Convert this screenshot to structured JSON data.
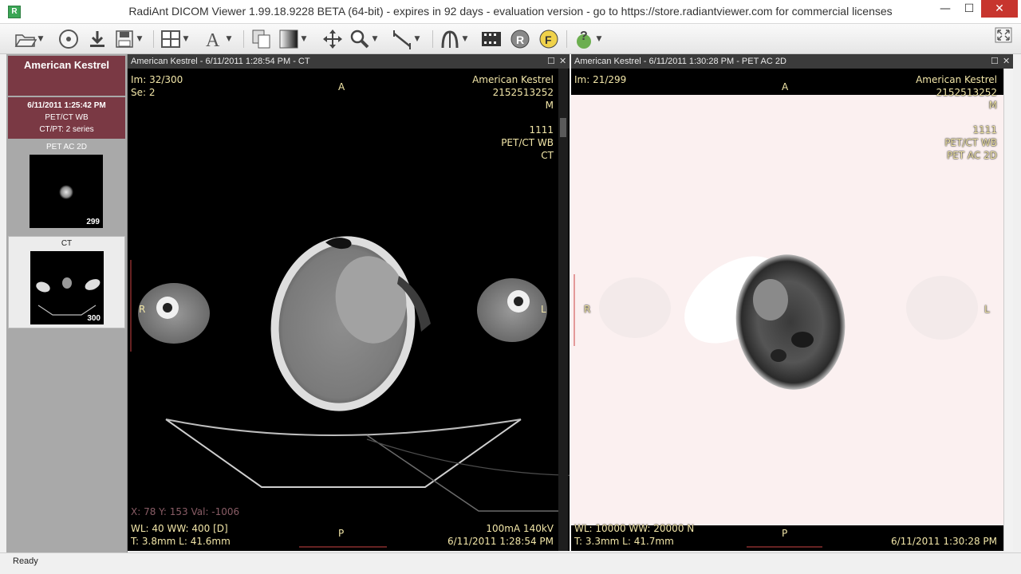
{
  "window": {
    "title": "RadiAnt DICOM Viewer 1.99.18.9228 BETA (64-bit) - expires in 92 days - evaluation version - go to https://store.radiantviewer.com for commercial licenses",
    "minimize": "—",
    "maximize": "☐",
    "close": "✕"
  },
  "toolbar": {
    "icons": [
      "open-folder",
      "open-cd",
      "download",
      "save",
      "layout",
      "annotation-text",
      "series-sync",
      "window-level",
      "pan",
      "zoom",
      "measure-line",
      "mpr",
      "cine",
      "3d-volume",
      "fusion",
      "help"
    ]
  },
  "sidebar": {
    "patient_name": "American Kestrel",
    "study": {
      "date": "6/11/2011 1:25:42 PM",
      "description": "PET/CT WB",
      "series_info": "CT/PT: 2 series"
    },
    "series": [
      {
        "label": "PET AC 2D",
        "count": "299"
      },
      {
        "label": "CT",
        "count": "300"
      }
    ]
  },
  "viewports": {
    "ct": {
      "header": "American Kestrel - 6/11/2011 1:28:54 PM - CT",
      "image_index": "Im: 32/300",
      "series_no": "Se: 2",
      "patient_name": "American Kestrel",
      "patient_id": "2152513252",
      "sex": "M",
      "accession": "1111",
      "study_desc": "PET/CT WB",
      "modality": "CT",
      "orient_top": "A",
      "orient_bottom": "P",
      "orient_left": "R",
      "orient_right": "L",
      "cursor_info": "X: 78 Y: 153 Val: -1006",
      "window_level": "WL: 40 WW: 400 [D]",
      "thickness": "T: 3.8mm L: 41.6mm",
      "acq": "100mA 140kV",
      "datetime": "6/11/2011 1:28:54 PM"
    },
    "pet": {
      "header": "American Kestrel - 6/11/2011 1:30:28 PM - PET AC 2D",
      "image_index": "Im: 21/299",
      "patient_name": "American Kestrel",
      "patient_id": "2152513252",
      "sex": "M",
      "accession": "1111",
      "study_desc": "PET/CT WB",
      "series_desc": "PET AC 2D",
      "orient_top": "A",
      "orient_bottom": "P",
      "orient_left": "R",
      "orient_right": "L",
      "window_level": "WL: 10000 WW: 20000 N",
      "thickness": "T: 3.3mm L: 41.7mm",
      "datetime": "6/11/2011 1:30:28 PM"
    }
  },
  "status": {
    "text": "Ready"
  },
  "colors": {
    "study_bg": "#7a3944",
    "overlay_text": "#f2e6a8",
    "close_btn": "#c7352e"
  }
}
